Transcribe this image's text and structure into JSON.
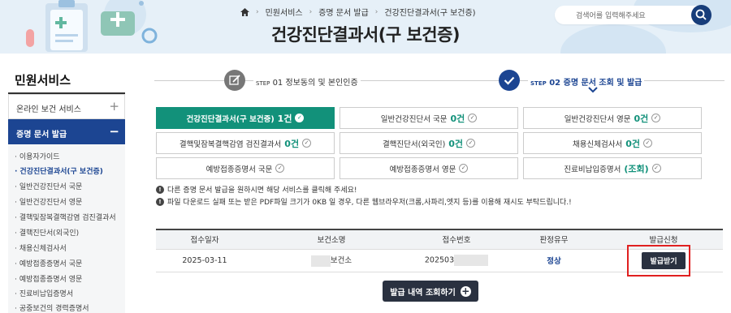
{
  "header": {
    "breadcrumb": [
      "민원서비스",
      "증명 문서 발급",
      "건강진단결과서(구 보건증)"
    ],
    "title": "건강진단결과서(구 보건증)",
    "search_placeholder": "검색어를 입력해주세요"
  },
  "sidebar": {
    "title": "민원서비스",
    "items": [
      {
        "label": "온라인 보건 서비스",
        "toggle": "+"
      },
      {
        "label": "증명 문서 발급",
        "toggle": "−"
      }
    ],
    "subitems": [
      "이용자가이드",
      "건강진단결과서(구 보건증)",
      "일반건강진단서 국문",
      "일반건강진단서 영문",
      "결핵및잠복결핵감염 검진결과서",
      "결핵진단서(외국인)",
      "채용신체검사서",
      "예방접종증명서 국문",
      "예방접종증명서 영문",
      "진료비납입증명서",
      "공중보건의 경력증명서"
    ]
  },
  "steps": [
    {
      "num": "STEP",
      "n": "01",
      "label": "정보동의 및 본인인증"
    },
    {
      "num": "STEP",
      "n": "02",
      "label": "증명 문서 조회 및 발급"
    }
  ],
  "docs": [
    {
      "label": "건강진단결과서(구 보건증)",
      "count": "1건",
      "selected": true
    },
    {
      "label": "일반건강진단서 국문",
      "count": "0건"
    },
    {
      "label": "일반건강진단서 영문",
      "count": "0건"
    },
    {
      "label": "결핵및잠복결핵감염 검진결과서",
      "count": "0건"
    },
    {
      "label": "결핵진단서(외국인)",
      "count": "0건"
    },
    {
      "label": "채용신체검사서",
      "count": "0건"
    },
    {
      "label": "예방접종증명서 국문",
      "count": ""
    },
    {
      "label": "예방접종증명서 영문",
      "count": ""
    },
    {
      "label": "진료비납입증명서",
      "count": "(조회)"
    }
  ],
  "notices": [
    "다른 증명 문서 발급을 원하시면 해당 서비스를 클릭해 주세요!",
    "파일 다운로드 실패 또는 받은 PDF파일 크기가 0KB 일 경우, 다른 웹브라우저(크롬,사파리,엣지 등)를 이용해 재시도 부탁드립니다.!"
  ],
  "table": {
    "headers": [
      "접수일자",
      "보건소명",
      "접수번호",
      "판정유무",
      "발급신청"
    ],
    "row": {
      "date": "2025-03-11",
      "center": "보건소",
      "receipt": "202503",
      "status": "정상",
      "issue_label": "발급받기"
    }
  },
  "view_button": "발급 내역 조회하기",
  "colors": {
    "primary": "#1c4592",
    "green": "#12917a",
    "dark_button": "#2a3140",
    "highlight": "#e02020"
  }
}
